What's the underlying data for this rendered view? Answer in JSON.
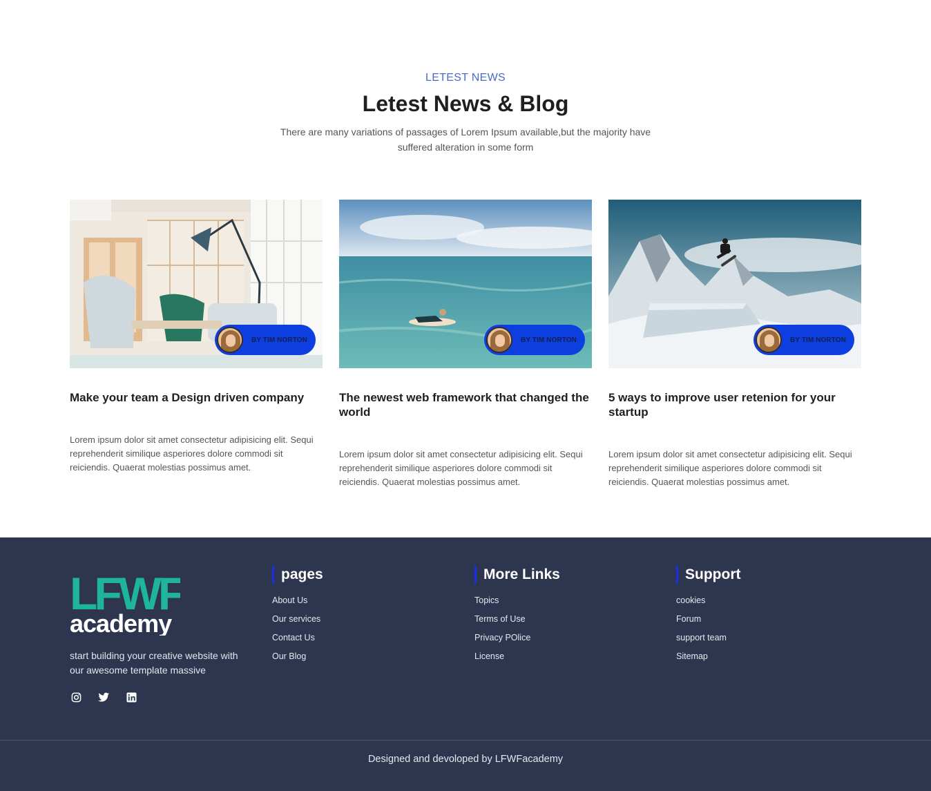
{
  "news": {
    "eyebrow": "LETEST NEWS",
    "title": "Letest News & Blog",
    "subtitle": "There are many variations of passages of Lorem Ipsum available,but the majority have suffered alteration in some form",
    "cards": [
      {
        "image": "office-lounge-photo",
        "author": "BY TIM NORTON",
        "title": "Make your team a Design driven company",
        "text": "Lorem ipsum dolor sit amet consectetur adipisicing elit. Sequi reprehenderit similique asperiores dolore commodi sit reiciendis. Quaerat molestias possimus amet."
      },
      {
        "image": "surfer-ocean-photo",
        "author": "BY TIM NORTON",
        "title": "The newest web framework that changed the world",
        "text": "Lorem ipsum dolor sit amet consectetur adipisicing elit. Sequi reprehenderit similique asperiores dolore commodi sit reiciendis. Quaerat molestias possimus amet."
      },
      {
        "image": "snowboarder-mountain-photo",
        "author": "BY TIM NORTON",
        "title": "5 ways to improve user retenion for your startup",
        "text": "Lorem ipsum dolor sit amet consectetur adipisicing elit. Sequi reprehenderit similique asperiores dolore commodi sit reiciendis. Quaerat molestias possimus amet."
      }
    ]
  },
  "footer": {
    "logo": {
      "top": "LFWF",
      "bottom": "academy"
    },
    "tagline": "start building your creative website with our awesome template massive",
    "socials": [
      "instagram-icon",
      "twitter-icon",
      "linkedin-icon"
    ],
    "columns": [
      {
        "heading": "pages",
        "links": [
          "About Us",
          "Our services",
          "Contact Us",
          "Our Blog"
        ]
      },
      {
        "heading": "More Links",
        "links": [
          "Topics",
          "Terms of Use",
          "Privacy POlice",
          "License"
        ]
      },
      {
        "heading": "Support",
        "links": [
          "cookies",
          "Forum",
          "support team",
          "Sitemap"
        ]
      }
    ],
    "credit": "Designed and devoloped by LFWFacademy"
  },
  "colors": {
    "accent_blue": "#0d3fe0",
    "eyebrow_blue": "#4a6bc7",
    "footer_bg": "#2e364f",
    "logo_teal": "#1fb59a",
    "heading_bar": "#1a2ee8"
  }
}
